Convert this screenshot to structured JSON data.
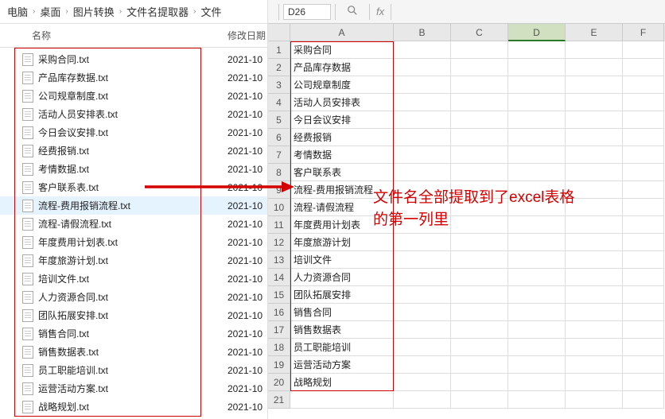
{
  "breadcrumb": [
    "电脑",
    "桌面",
    "图片转换",
    "文件名提取器",
    "文件"
  ],
  "file_header": {
    "name": "名称",
    "date": "修改日期"
  },
  "files": [
    {
      "name": "采购合同.txt",
      "date": "2021-10",
      "selected": false
    },
    {
      "name": "产品库存数据.txt",
      "date": "2021-10",
      "selected": false
    },
    {
      "name": "公司规章制度.txt",
      "date": "2021-10",
      "selected": false
    },
    {
      "name": "活动人员安排表.txt",
      "date": "2021-10",
      "selected": false
    },
    {
      "name": "今日会议安排.txt",
      "date": "2021-10",
      "selected": false
    },
    {
      "name": "经费报销.txt",
      "date": "2021-10",
      "selected": false
    },
    {
      "name": "考情数据.txt",
      "date": "2021-10",
      "selected": false
    },
    {
      "name": "客户联系表.txt",
      "date": "2021-10",
      "selected": false
    },
    {
      "name": "流程-费用报销流程.txt",
      "date": "2021-10",
      "selected": true
    },
    {
      "name": "流程-请假流程.txt",
      "date": "2021-10",
      "selected": false
    },
    {
      "name": "年度费用计划表.txt",
      "date": "2021-10",
      "selected": false
    },
    {
      "name": "年度旅游计划.txt",
      "date": "2021-10",
      "selected": false
    },
    {
      "name": "培训文件.txt",
      "date": "2021-10",
      "selected": false
    },
    {
      "name": "人力资源合同.txt",
      "date": "2021-10",
      "selected": false
    },
    {
      "name": "团队拓展安排.txt",
      "date": "2021-10",
      "selected": false
    },
    {
      "name": "销售合同.txt",
      "date": "2021-10",
      "selected": false
    },
    {
      "name": "销售数据表.txt",
      "date": "2021-10",
      "selected": false
    },
    {
      "name": "员工职能培训.txt",
      "date": "2021-10",
      "selected": false
    },
    {
      "name": "运营活动方案.txt",
      "date": "2021-10",
      "selected": false
    },
    {
      "name": "战略规划.txt",
      "date": "2021-10",
      "selected": false
    }
  ],
  "excel": {
    "namebox": "D26",
    "fx_label": "fx",
    "columns": [
      "A",
      "B",
      "C",
      "D",
      "E",
      "F"
    ],
    "selected_col": "D",
    "rows": [
      {
        "n": 1,
        "A": "采购合同"
      },
      {
        "n": 2,
        "A": "产品库存数据"
      },
      {
        "n": 3,
        "A": "公司规章制度"
      },
      {
        "n": 4,
        "A": "活动人员安排表"
      },
      {
        "n": 5,
        "A": "今日会议安排"
      },
      {
        "n": 6,
        "A": "经费报销"
      },
      {
        "n": 7,
        "A": "考情数据"
      },
      {
        "n": 8,
        "A": "客户联系表"
      },
      {
        "n": 9,
        "A": "流程-费用报销流程"
      },
      {
        "n": 10,
        "A": "流程-请假流程"
      },
      {
        "n": 11,
        "A": "年度费用计划表"
      },
      {
        "n": 12,
        "A": "年度旅游计划"
      },
      {
        "n": 13,
        "A": "培训文件"
      },
      {
        "n": 14,
        "A": "人力资源合同"
      },
      {
        "n": 15,
        "A": "团队拓展安排"
      },
      {
        "n": 16,
        "A": "销售合同"
      },
      {
        "n": 17,
        "A": "销售数据表"
      },
      {
        "n": 18,
        "A": "员工职能培训"
      },
      {
        "n": 19,
        "A": "运营活动方案"
      },
      {
        "n": 20,
        "A": "战略规划"
      },
      {
        "n": 21,
        "A": ""
      }
    ]
  },
  "annotation": {
    "line1": "文件名全部提取到了excel表格",
    "line2": "的第一列里"
  }
}
